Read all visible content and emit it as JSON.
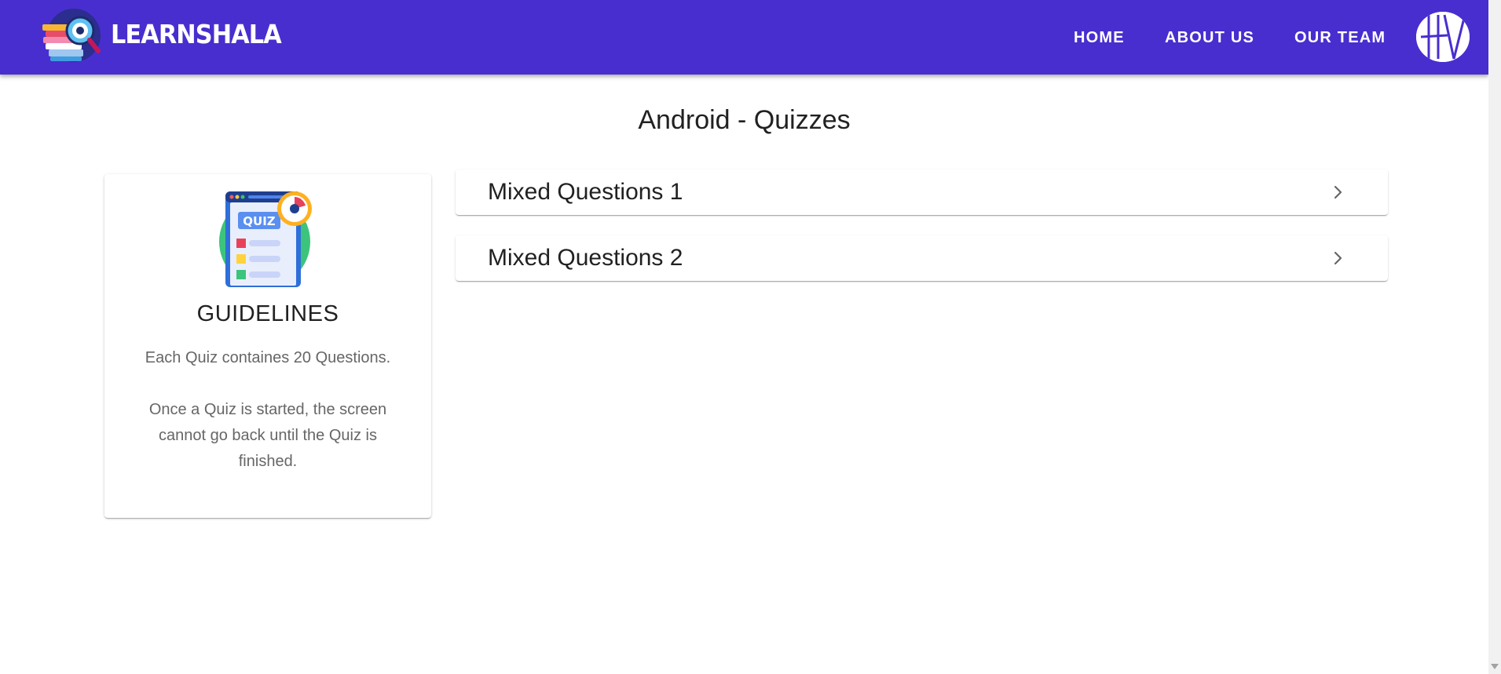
{
  "header": {
    "brand": "LEARNSHALA",
    "nav": [
      {
        "label": "HOME"
      },
      {
        "label": "ABOUT US"
      },
      {
        "label": "OUR TEAM"
      }
    ],
    "logo_icon": "books-magnifier-logo",
    "avatar_icon": "hv-monogram-avatar",
    "color": "#482ecf"
  },
  "main": {
    "title": "Android - Quizzes",
    "guidelines": {
      "image_text": "QUIZ",
      "title": "GUIDELINES",
      "line1": "Each Quiz containes 20 Questions.",
      "line2": "Once a Quiz is started, the screen cannot go back until the Quiz is finished."
    },
    "quizzes": [
      {
        "label": "Mixed Questions 1"
      },
      {
        "label": "Mixed Questions 2"
      }
    ]
  }
}
